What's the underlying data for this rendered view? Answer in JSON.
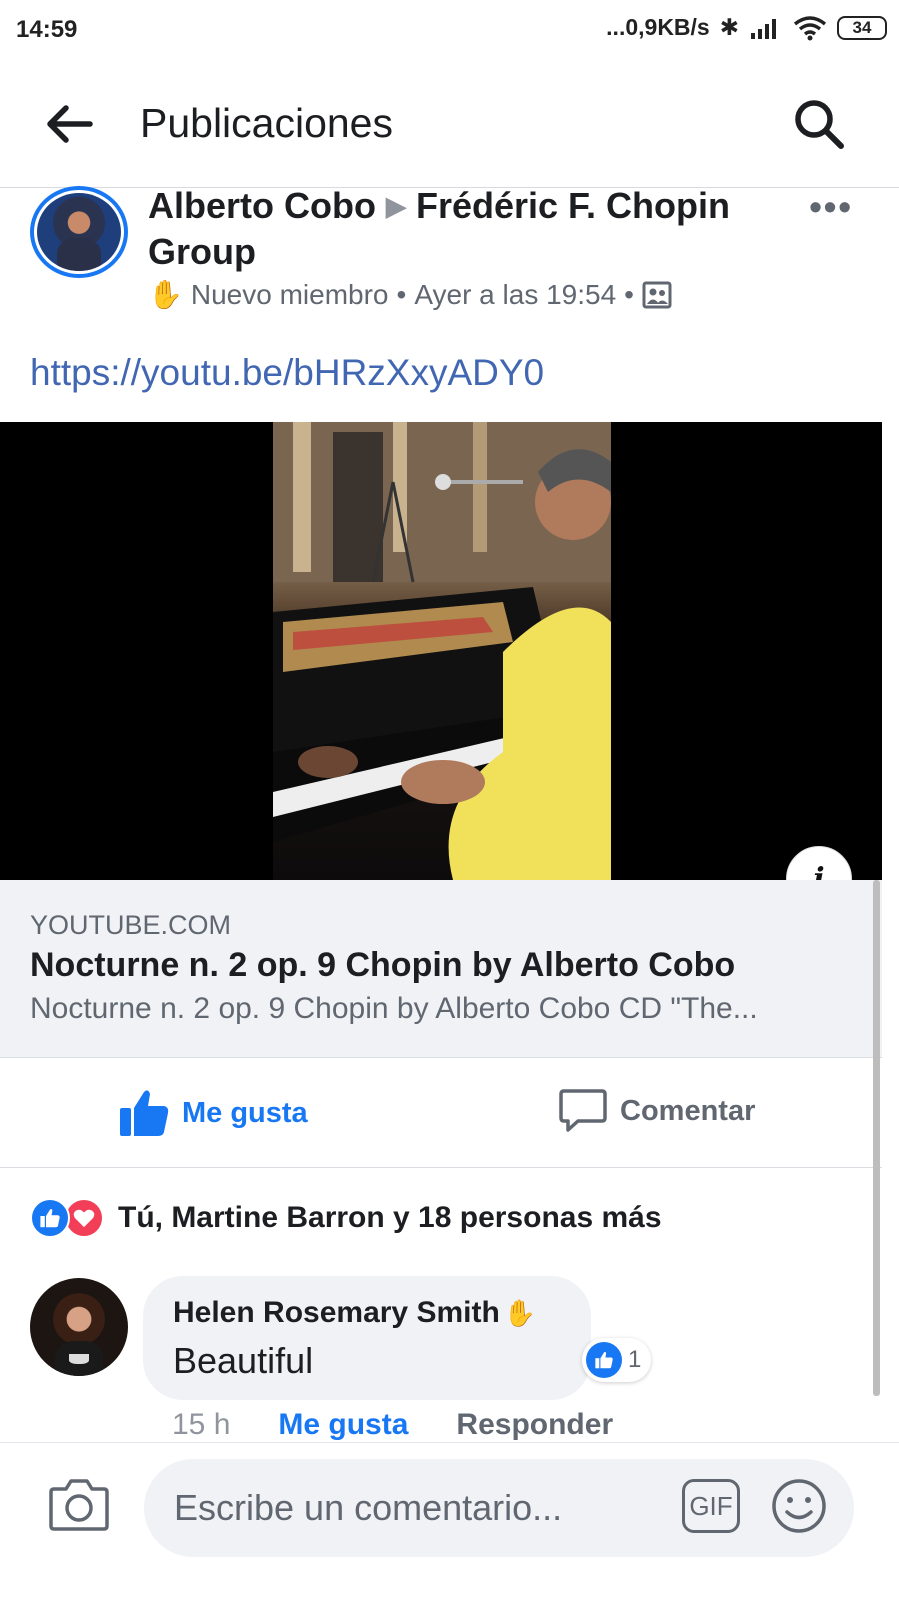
{
  "status_bar": {
    "time": "14:59",
    "net_speed": "...0,9KB/s",
    "battery": "34"
  },
  "header": {
    "title": "Publicaciones"
  },
  "post": {
    "author": "Alberto Cobo",
    "group": "Frédéric F. Chopin Group",
    "badge": "Nuevo miembro",
    "separator": "•",
    "timestamp": "Ayer a las 19:54",
    "link_text": "https://youtu.be/bHRzXxyADY0"
  },
  "preview": {
    "domain": "YOUTUBE.COM",
    "title": "Nocturne n. 2 op. 9 Chopin by Alberto Cobo",
    "description": "Nocturne n. 2 op. 9 Chopin by Alberto Cobo CD \"The..."
  },
  "actions": {
    "like_label": "Me gusta",
    "comment_label": "Comentar"
  },
  "reactions": {
    "summary": "Tú, Martine Barron y 18 personas más"
  },
  "comment": {
    "author": "Helen Rosemary Smith",
    "text": "Beautiful",
    "reaction_count": "1",
    "time": "15 h",
    "like_label": "Me gusta",
    "reply_label": "Responder"
  },
  "composer": {
    "placeholder": "Escribe un comentario...",
    "gif_label": "GIF"
  },
  "colors": {
    "accent": "#1877f2",
    "link": "#4267b2",
    "love": "#f33e58",
    "muted": "#606770"
  }
}
